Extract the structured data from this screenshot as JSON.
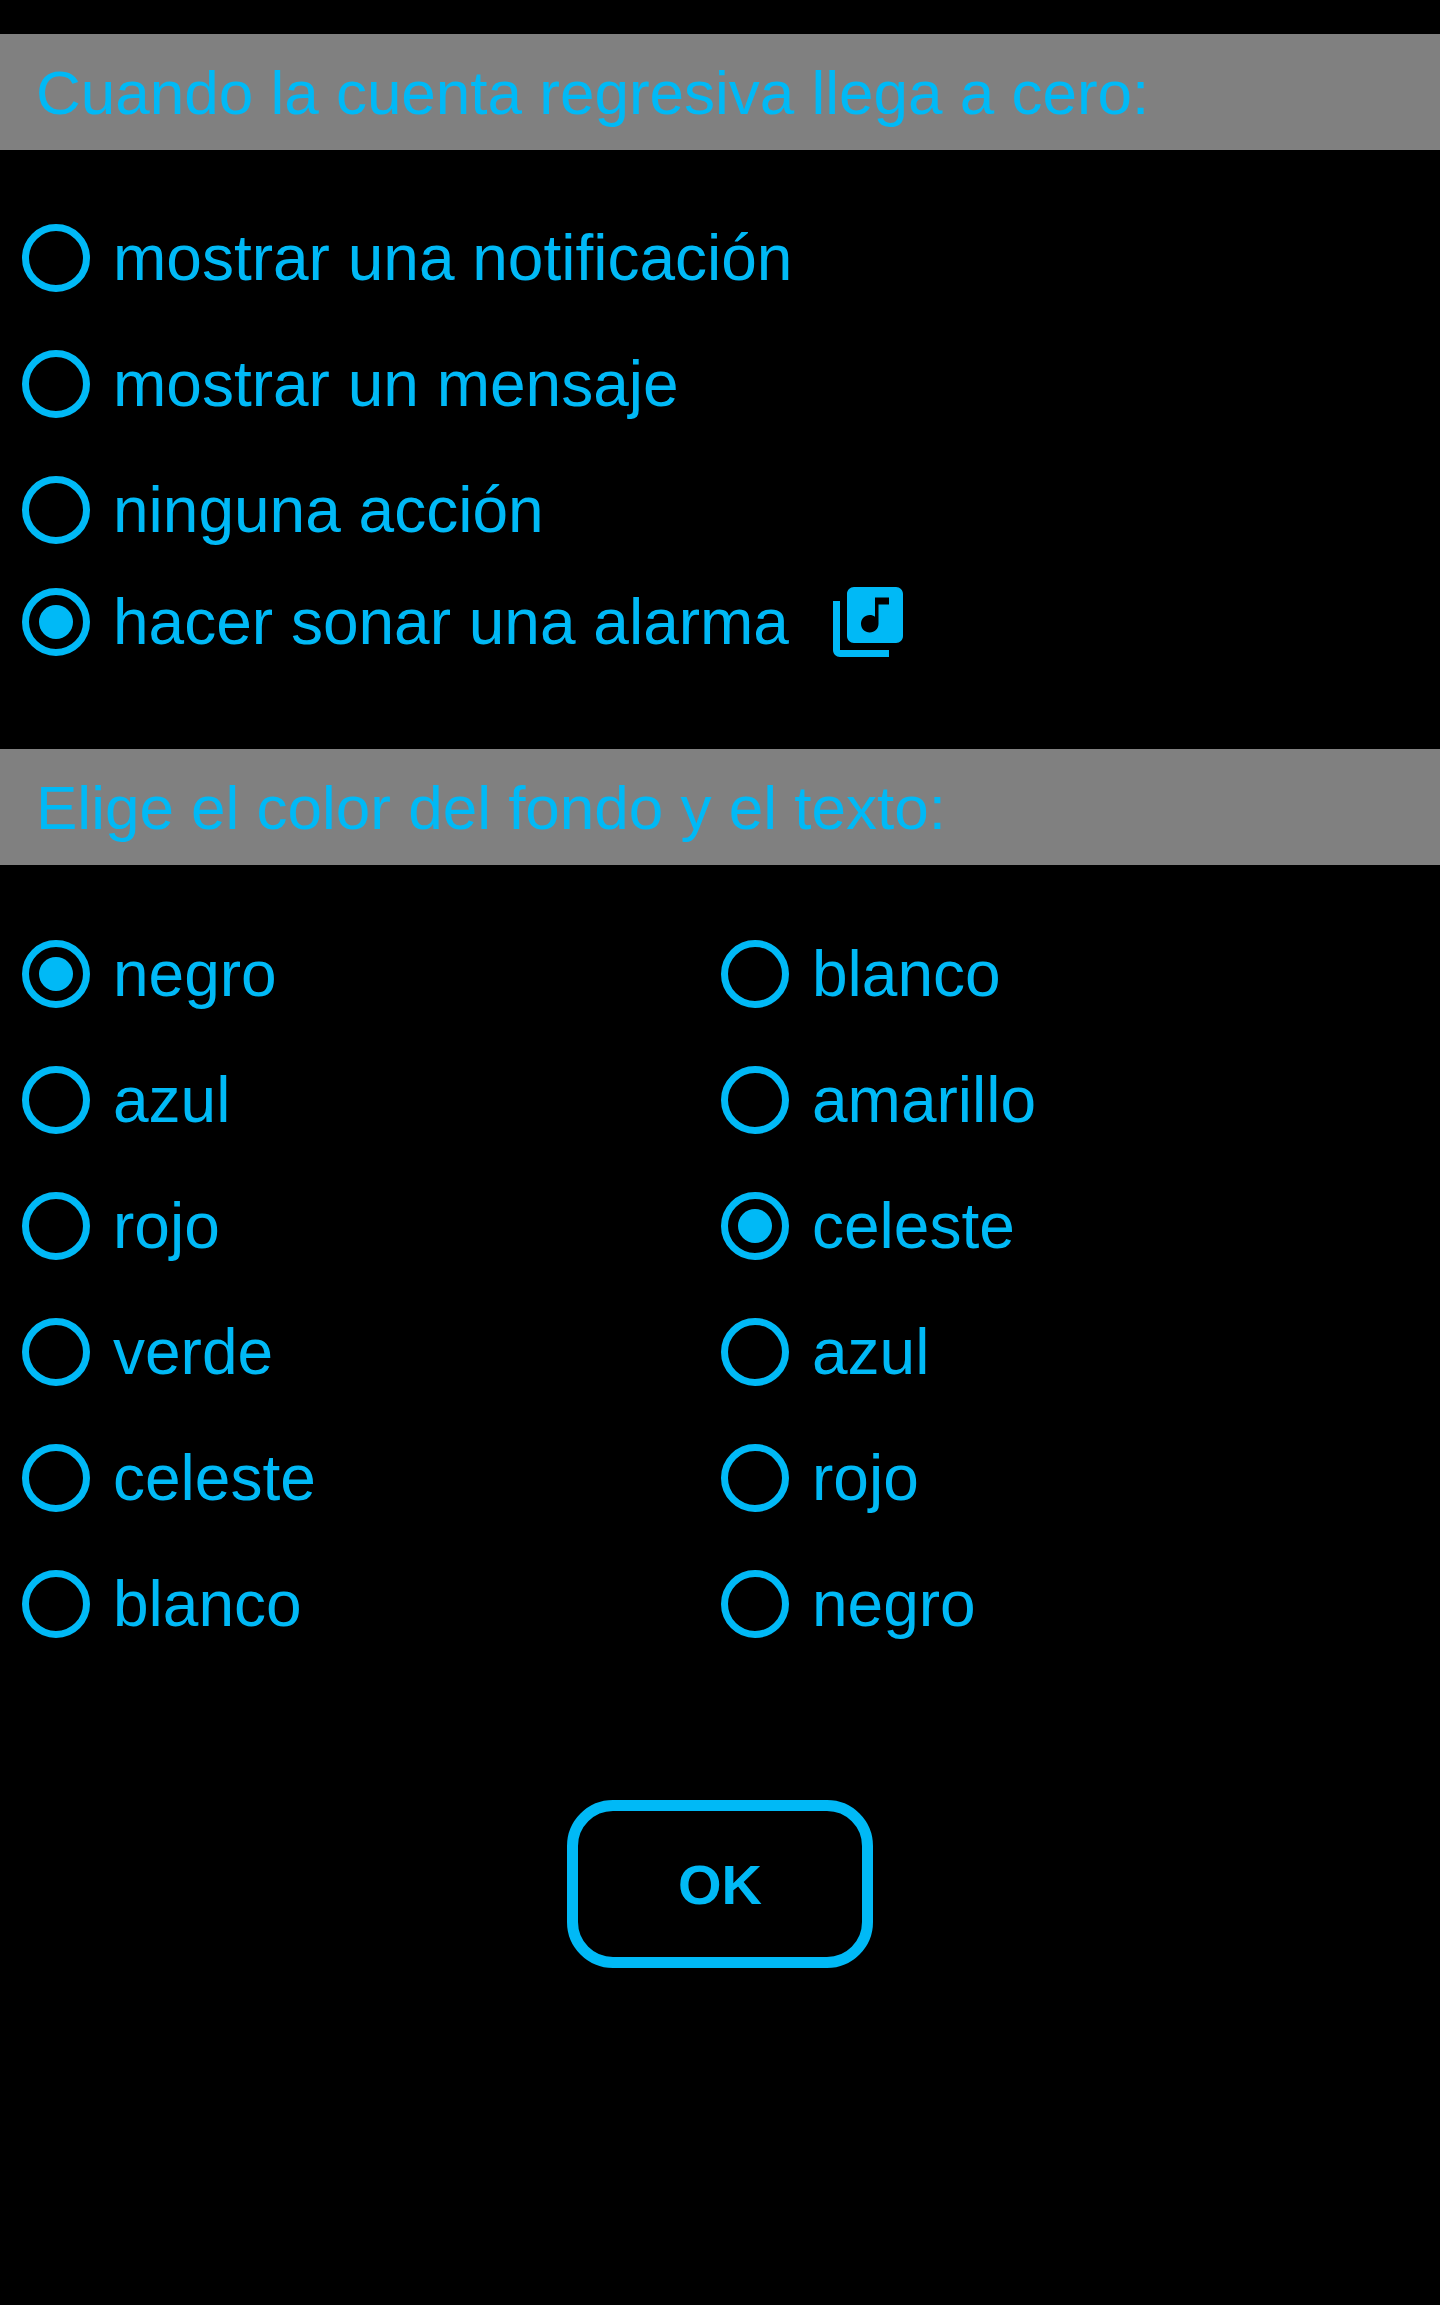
{
  "sections": [
    {
      "title": "Cuando la cuenta regresiva llega a cero:",
      "options": [
        {
          "label": "mostrar una notificación",
          "selected": false,
          "kind": "plain"
        },
        {
          "label": "mostrar un mensaje",
          "selected": false,
          "kind": "plain"
        },
        {
          "label": "ninguna acción",
          "selected": false,
          "kind": "plain"
        },
        {
          "label": "hacer sonar una alarma",
          "selected": true,
          "kind": "sound"
        }
      ]
    },
    {
      "title": "Elige el color del fondo y el texto:",
      "columns": [
        {
          "options": [
            {
              "label": "negro",
              "selected": true
            },
            {
              "label": "azul",
              "selected": false
            },
            {
              "label": "rojo",
              "selected": false
            },
            {
              "label": "verde",
              "selected": false
            },
            {
              "label": "celeste",
              "selected": false
            },
            {
              "label": "blanco",
              "selected": false
            }
          ]
        },
        {
          "options": [
            {
              "label": "blanco",
              "selected": false
            },
            {
              "label": "amarillo",
              "selected": false
            },
            {
              "label": "celeste",
              "selected": true
            },
            {
              "label": "azul",
              "selected": false
            },
            {
              "label": "rojo",
              "selected": false
            },
            {
              "label": "negro",
              "selected": false
            }
          ]
        }
      ]
    }
  ],
  "buttons": [
    {
      "label": "OK"
    }
  ]
}
